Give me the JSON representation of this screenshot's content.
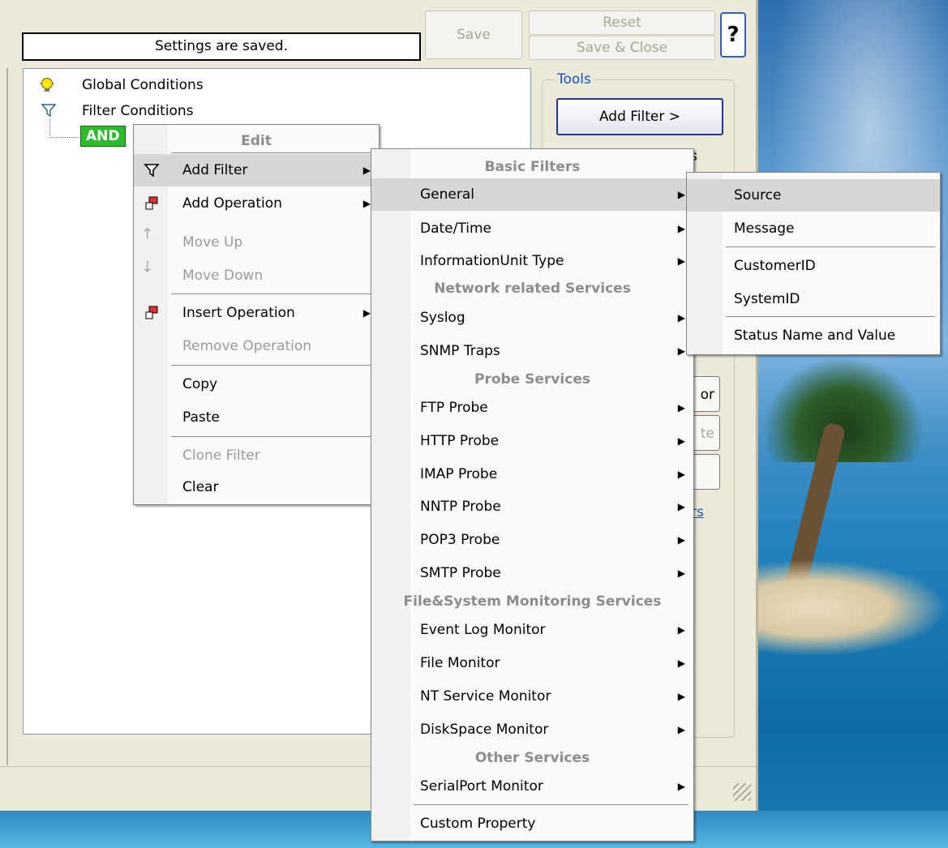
{
  "window": {
    "status_text": "Settings are saved.",
    "buttons": {
      "save": "Save",
      "reset": "Reset",
      "save_close": "Save & Close",
      "help": "?"
    },
    "tree": {
      "global_conditions": "Global Conditions",
      "filter_conditions": "Filter Conditions",
      "and_node": "AND"
    },
    "tools": {
      "legend": "Tools",
      "add_filter": "Add Filter >",
      "partial_or": "or",
      "partial_te": "te",
      "partial_s": "s",
      "link_partial": "rs"
    }
  },
  "menu_edit": {
    "header": "Edit",
    "items": [
      {
        "label": "Add Filter",
        "enabled": true,
        "submenu": true,
        "highlighted": true,
        "icon": "funnel-icon"
      },
      {
        "label": "Add Operation",
        "enabled": true,
        "submenu": true,
        "icon": "operation-icon"
      },
      {
        "label": "Move Up",
        "enabled": false,
        "icon": "arrow-up-icon"
      },
      {
        "label": "Move Down",
        "enabled": false,
        "icon": "arrow-down-icon"
      },
      {
        "label": "Insert Operation",
        "enabled": true,
        "submenu": true,
        "icon": "operation-icon"
      },
      {
        "label": "Remove Operation",
        "enabled": false
      },
      {
        "label": "Copy",
        "enabled": true
      },
      {
        "label": "Paste",
        "enabled": true
      },
      {
        "label": "Clone Filter",
        "enabled": false
      },
      {
        "label": "Clear",
        "enabled": true
      }
    ]
  },
  "menu_filters": {
    "headers": {
      "basic": "Basic Filters",
      "network": "Network related Services",
      "probe": "Probe Services",
      "filesystem": "File&System Monitoring Services",
      "other": "Other Services"
    },
    "items": {
      "general": "General",
      "datetime": "Date/Time",
      "infounit": "InformationUnit Type",
      "syslog": "Syslog",
      "snmp": "SNMP Traps",
      "ftp": "FTP Probe",
      "http": "HTTP Probe",
      "imap": "IMAP Probe",
      "nntp": "NNTP Probe",
      "pop3": "POP3 Probe",
      "smtp": "SMTP Probe",
      "eventlog": "Event Log Monitor",
      "filemon": "File Monitor",
      "ntservice": "NT Service Monitor",
      "diskspace": "DiskSpace Monitor",
      "serialport": "SerialPort Monitor",
      "custom": "Custom Property"
    }
  },
  "menu_general": {
    "items": [
      "Source",
      "Message",
      "CustomerID",
      "SystemID",
      "Status Name and Value"
    ]
  },
  "colors": {
    "and_node_bg": "#2dbb2d",
    "tools_legend": "#1450c8",
    "menu_highlight": "#d6d6d6"
  }
}
